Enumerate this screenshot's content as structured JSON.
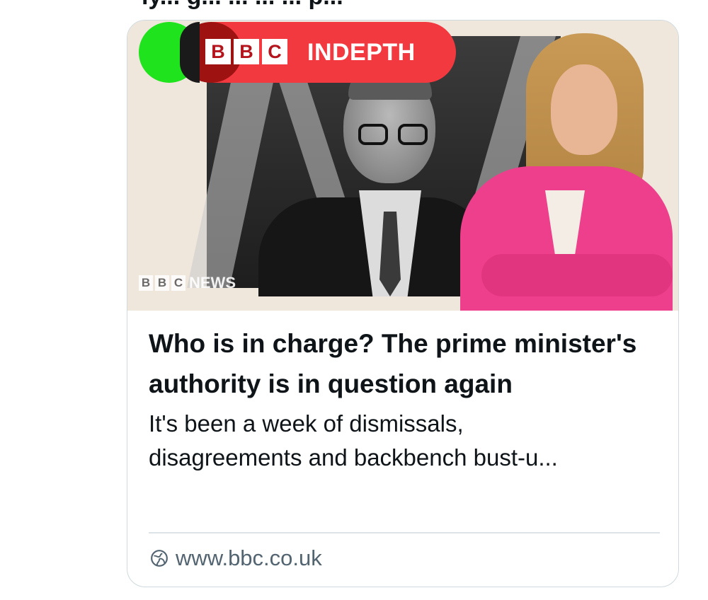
{
  "top_text": "ly... g... ... ... ... p...",
  "card": {
    "image": {
      "badge": {
        "bbc_letters": [
          "B",
          "B",
          "C"
        ],
        "label": "INDEPTH"
      },
      "watermark": {
        "bbc_letters": [
          "B",
          "B",
          "C"
        ],
        "label": "NEWS"
      }
    },
    "headline": "Who is in charge? The prime minister's authority is in question again",
    "description": "It's been a week of dismissals,\ndisagreements and backbench bust-u...",
    "domain": {
      "icon": "globe-icon",
      "text": "www.bbc.co.uk"
    }
  },
  "colors": {
    "badge_red": "#f2393f",
    "badge_green": "#1fe31c",
    "jacket_pink": "#ee3f8c",
    "text_primary": "#0f1419",
    "text_secondary": "#536471",
    "border": "#cfd9de"
  }
}
